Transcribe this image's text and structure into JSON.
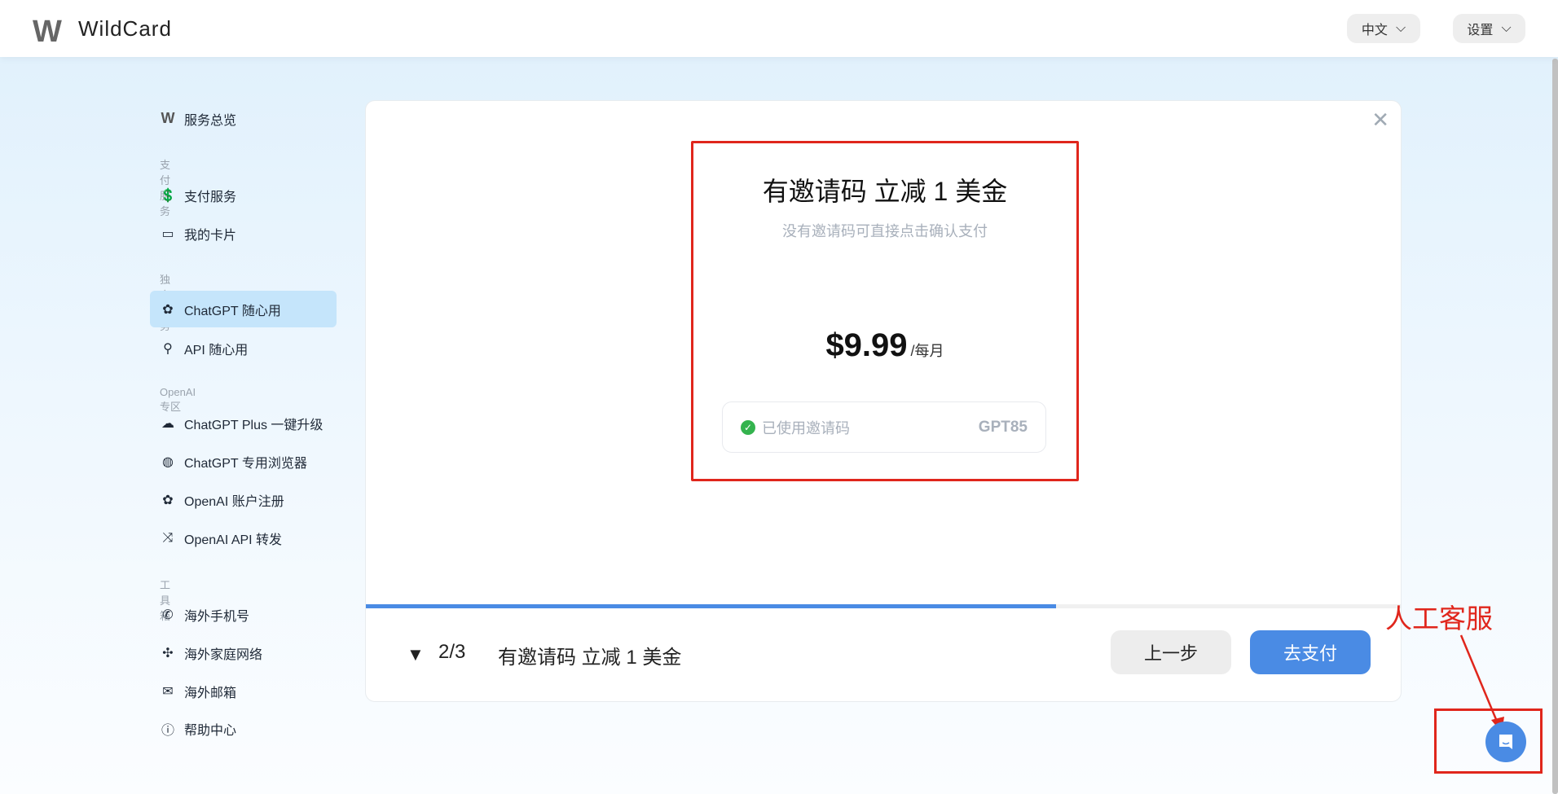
{
  "header": {
    "brand": "WildCard",
    "logo": "W",
    "language": "中文",
    "settings": "设置"
  },
  "sidebar": {
    "overview": "服务总览",
    "sections": [
      {
        "title": "支付服务",
        "items": [
          {
            "label": "支付服务",
            "icon": "hand-coin-icon"
          },
          {
            "label": "我的卡片",
            "icon": "card-icon"
          }
        ]
      },
      {
        "title": "独立服务",
        "items": [
          {
            "label": "ChatGPT 随心用",
            "icon": "openai-icon",
            "active": true
          },
          {
            "label": "API 随心用",
            "icon": "plug-icon"
          }
        ]
      },
      {
        "title": "OpenAI 专区",
        "items": [
          {
            "label": "ChatGPT Plus 一键升级",
            "icon": "cloud-upload-icon"
          },
          {
            "label": "ChatGPT 专用浏览器",
            "icon": "globe-icon"
          },
          {
            "label": "OpenAI 账户注册",
            "icon": "openai-user-icon"
          },
          {
            "label": "OpenAI API 转发",
            "icon": "shuffle-icon"
          }
        ]
      },
      {
        "title": "工具箱",
        "items": [
          {
            "label": "海外手机号",
            "icon": "phone-icon"
          },
          {
            "label": "海外家庭网络",
            "icon": "puzzle-icon"
          },
          {
            "label": "海外邮箱",
            "icon": "mail-icon"
          },
          {
            "label": "帮助中心",
            "icon": "help-icon"
          }
        ]
      }
    ]
  },
  "modal": {
    "title": "有邀请码 立减 1 美金",
    "subtitle": "没有邀请码可直接点击确认支付",
    "price": "$9.99",
    "period": "/每月",
    "invite_label": "已使用邀请码",
    "invite_code": "GPT85",
    "progress_percent": 66.7,
    "step": "2/3",
    "step_title": "有邀请码 立减 1 美金",
    "prev_label": "上一步",
    "pay_label": "去支付"
  },
  "annotation": {
    "label": "人工客服",
    "color": "#e0261c"
  },
  "colors": {
    "accent": "#4a8be4",
    "active_bg": "#c5e5fb"
  }
}
